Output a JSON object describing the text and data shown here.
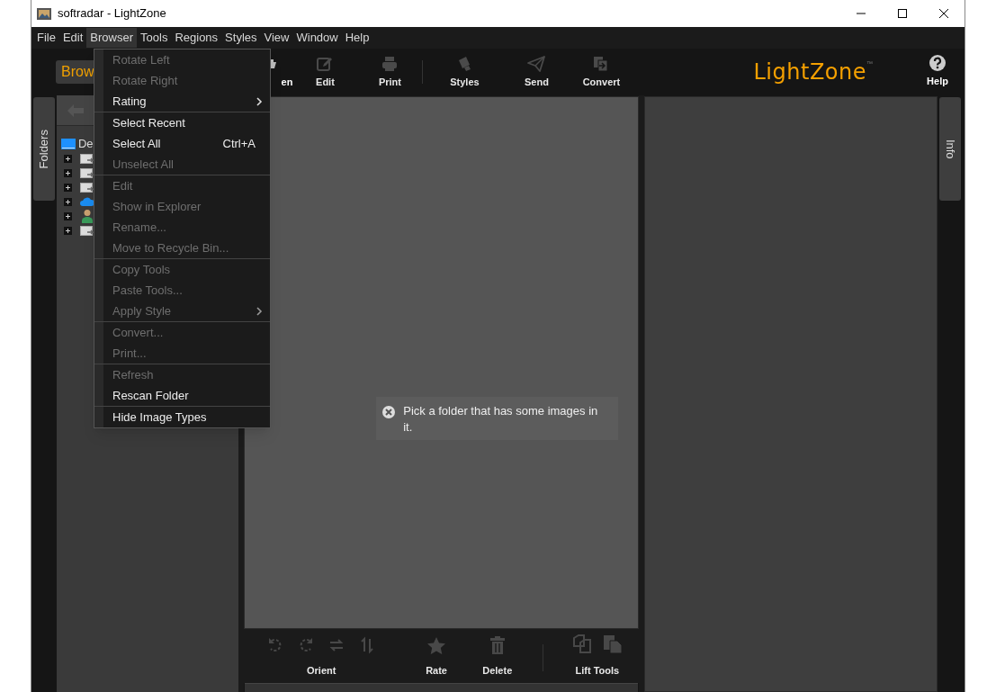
{
  "window": {
    "title": "softradar - LightZone"
  },
  "menubar": [
    {
      "label": "File",
      "selected": false
    },
    {
      "label": "Edit",
      "selected": false
    },
    {
      "label": "Browser",
      "selected": true
    },
    {
      "label": "Tools",
      "selected": false
    },
    {
      "label": "Regions",
      "selected": false
    },
    {
      "label": "Styles",
      "selected": false
    },
    {
      "label": "View",
      "selected": false
    },
    {
      "label": "Window",
      "selected": false
    },
    {
      "label": "Help",
      "selected": false
    }
  ],
  "mode_button": {
    "label": "Brow"
  },
  "toolbar": [
    {
      "kind": "open",
      "label": "en",
      "disabled": false
    },
    {
      "kind": "edit",
      "label": "Edit",
      "disabled": true
    },
    {
      "kind": "print",
      "label": "Print",
      "disabled": true
    },
    {
      "kind": "styles",
      "label": "Styles",
      "disabled": true
    },
    {
      "kind": "send",
      "label": "Send",
      "disabled": true
    },
    {
      "kind": "convert",
      "label": "Convert",
      "disabled": true
    }
  ],
  "logo": {
    "text": "LightZone",
    "mark": "™"
  },
  "help": {
    "label": "Help"
  },
  "side_tabs": {
    "left": "Folders",
    "right": "Info"
  },
  "tree": [
    {
      "kind": "desktop",
      "label": "De",
      "children": [
        {
          "kind": "drive"
        },
        {
          "kind": "drive"
        },
        {
          "kind": "drive"
        },
        {
          "kind": "cloud"
        },
        {
          "kind": "user"
        },
        {
          "kind": "drive"
        }
      ]
    }
  ],
  "browser_menu": [
    [
      {
        "label": "Rotate Left",
        "disabled": true
      },
      {
        "label": "Rotate Right",
        "disabled": true
      },
      {
        "label": "Rating",
        "disabled": false,
        "submenu": true
      }
    ],
    [
      {
        "label": "Select Recent",
        "disabled": false
      },
      {
        "label": "Select All",
        "disabled": false,
        "shortcut": "Ctrl+A"
      },
      {
        "label": "Unselect All",
        "disabled": true
      }
    ],
    [
      {
        "label": "Edit",
        "disabled": true
      },
      {
        "label": "Show in Explorer",
        "disabled": true
      },
      {
        "label": "Rename...",
        "disabled": true
      },
      {
        "label": "Move to Recycle Bin...",
        "disabled": true
      }
    ],
    [
      {
        "label": "Copy Tools",
        "disabled": true
      },
      {
        "label": "Paste Tools...",
        "disabled": true
      },
      {
        "label": "Apply Style",
        "disabled": true,
        "submenu": true
      }
    ],
    [
      {
        "label": "Convert...",
        "disabled": true
      },
      {
        "label": "Print...",
        "disabled": true
      }
    ],
    [
      {
        "label": "Refresh",
        "disabled": true
      },
      {
        "label": "Rescan Folder",
        "disabled": false
      }
    ],
    [
      {
        "label": "Hide Image Types",
        "disabled": false
      }
    ]
  ],
  "message": {
    "text": "Pick a folder that has some images in it."
  },
  "bottom_toolbar": [
    {
      "kind": "orient",
      "label": "Orient"
    },
    {
      "kind": "rate",
      "label": "Rate"
    },
    {
      "kind": "delete",
      "label": "Delete"
    },
    {
      "kind": "lift",
      "label": "Lift Tools"
    }
  ]
}
